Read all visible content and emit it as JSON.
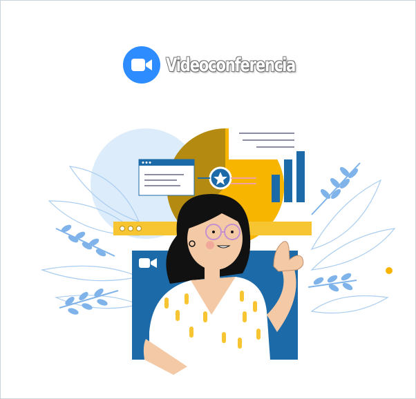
{
  "logo": {
    "icon": "video-camera-icon",
    "title": "Videoconferencia"
  },
  "colors": {
    "brand_blue": "#2d8cff",
    "illustration_blue": "#1c6aa8",
    "accent_yellow": "#f7b500",
    "skin": "#f3c9a6",
    "hair": "#111111",
    "leaf_blue": "#7fb3ea"
  }
}
